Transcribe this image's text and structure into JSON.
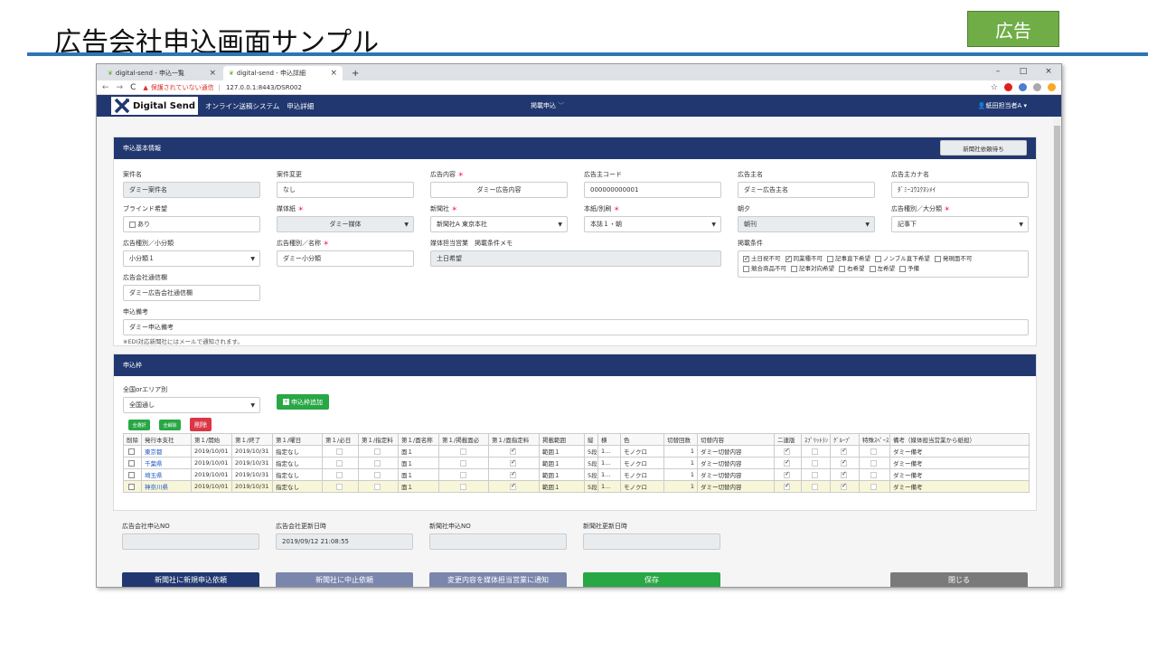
{
  "slide": {
    "title": "広告会社申込画面サンプル",
    "badge": "広告"
  },
  "browser": {
    "tabs": [
      {
        "label": "digital-send - 申込一覧"
      },
      {
        "label": "digital-send - 申込詳細"
      }
    ],
    "tab_close": "×",
    "new_tab": "+",
    "win": {
      "min": "–",
      "max": "□",
      "close": "×"
    },
    "nav": {
      "back": "←",
      "fwd": "→",
      "reload": "C"
    },
    "insecure": "保護されていない通信",
    "url": "127.0.0.1:8443/DSR002",
    "star": "☆"
  },
  "app": {
    "logo": "Digital Send",
    "system": "オンライン送稿システム",
    "screen": "申込詳細",
    "menu": "掲載申込",
    "user": "紙田担当者A"
  },
  "basic": {
    "title": "申込基本情報",
    "status": "新聞社依頼待ち",
    "f1": {
      "label": "案件名",
      "value": "ダミー案件名"
    },
    "f2": {
      "label": "案件変更",
      "value": "なし"
    },
    "f3": {
      "label": "広告内容",
      "value": "ダミー広告内容"
    },
    "f4": {
      "label": "広告主コード",
      "value": "000000000001"
    },
    "f5": {
      "label": "広告主名",
      "value": "ダミー広告主名"
    },
    "f6": {
      "label": "広告主カナ名",
      "value": "ﾀﾞﾐｰｺｳｺｸﾇｼﾒｲ"
    },
    "f7": {
      "label": "ブラインド希望",
      "value": "あり"
    },
    "f8": {
      "label": "媒体紙",
      "value": "ダミー媒体"
    },
    "f9": {
      "label": "新聞社",
      "value": "新聞社A 東京本社"
    },
    "f10": {
      "label": "本紙/別刷",
      "value": "本誌１・朝"
    },
    "f11": {
      "label": "朝夕",
      "value": "朝刊"
    },
    "f12": {
      "label": "広告種別／大分類",
      "value": "記事下"
    },
    "f13": {
      "label": "広告種別／小分類",
      "value": "小分類１"
    },
    "f14": {
      "label": "広告種別／名称",
      "value": "ダミー小分類"
    },
    "f15": {
      "label": "媒体担当営業　掲載条件メモ",
      "value": "土日希望"
    },
    "f16": {
      "label": "掲載条件"
    },
    "f17": {
      "label": "広告会社通信欄",
      "value": "ダミー広告会社通信欄"
    },
    "f18": {
      "label": "申込備考",
      "value": "ダミー申込備考"
    },
    "conditions": [
      {
        "label": "土日祝不可",
        "on": true
      },
      {
        "label": "同業種不可",
        "on": true
      },
      {
        "label": "記事直下希望",
        "on": false
      },
      {
        "label": "ノンブル直下希望",
        "on": false
      },
      {
        "label": "発現面不可",
        "on": false
      },
      {
        "label": "競合商品不可",
        "on": false
      },
      {
        "label": "記事対向希望",
        "on": false
      },
      {
        "label": "右希望",
        "on": false
      },
      {
        "label": "左希望",
        "on": false
      },
      {
        "label": "予備",
        "on": false
      }
    ],
    "note": "※EDI対応新聞社にはメールで通知されます。",
    "required_mark": "＊"
  },
  "frames": {
    "title": "申込枠",
    "area": {
      "label": "全国orエリア別",
      "value": "全国通し"
    },
    "add": "申込枠追加",
    "select_all": "全選択",
    "deselect_all": "全解除",
    "delete": "削除",
    "columns": [
      "削除",
      "発行本支社",
      "第１/開始",
      "第１/終了",
      "第１/曜日",
      "第１/必日",
      "第１/指定料",
      "第１/面名称",
      "第１/掲載面必",
      "第１/面指定料",
      "掲載範囲",
      "縦",
      "横",
      "色",
      "切替回数",
      "切替内容",
      "二連版",
      "ｽﾌﾟﾘｯﾄﾗﾝ",
      "ｸﾞﾙｰﾌﾟ",
      "特殊ｽﾍﾟｰｽ",
      "備考（媒体担当営業から紙担）"
    ],
    "rows": [
      {
        "branch": "東京都",
        "start": "2019/10/01",
        "end": "2019/10/31",
        "dow": "指定なし",
        "men": "面１",
        "range": "範囲１",
        "tate": "5段",
        "yoko": "1...",
        "color": "モノクロ",
        "cnt": "1",
        "sw": "ダミー切替内容",
        "memo": "ダミー備考"
      },
      {
        "branch": "千葉県",
        "start": "2019/10/01",
        "end": "2019/10/31",
        "dow": "指定なし",
        "men": "面１",
        "range": "範囲１",
        "tate": "5段",
        "yoko": "1...",
        "color": "モノクロ",
        "cnt": "1",
        "sw": "ダミー切替内容",
        "memo": "ダミー備考"
      },
      {
        "branch": "埼玉県",
        "start": "2019/10/01",
        "end": "2019/10/31",
        "dow": "指定なし",
        "men": "面１",
        "range": "範囲１",
        "tate": "5段",
        "yoko": "1...",
        "color": "モノクロ",
        "cnt": "1",
        "sw": "ダミー切替内容",
        "memo": "ダミー備考"
      },
      {
        "branch": "神奈川県",
        "start": "2019/10/01",
        "end": "2019/10/31",
        "dow": "指定なし",
        "men": "面１",
        "range": "範囲１",
        "tate": "5段",
        "yoko": "1...",
        "color": "モノクロ",
        "cnt": "1",
        "sw": "ダミー切替内容",
        "memo": "ダミー備考"
      }
    ]
  },
  "meta": {
    "m1": {
      "label": "広告会社申込NO",
      "value": ""
    },
    "m2": {
      "label": "広告会社更新日時",
      "value": "2019/09/12 21:08:55"
    },
    "m3": {
      "label": "新聞社申込NO",
      "value": ""
    },
    "m4": {
      "label": "新聞社更新日時",
      "value": ""
    }
  },
  "footer": {
    "b1": "新聞社に新規申込依頼",
    "b2": "新聞社に中止依頼",
    "b3": "変更内容を媒体担当営業に通知",
    "b4": "保存",
    "b5": "閉じる"
  }
}
